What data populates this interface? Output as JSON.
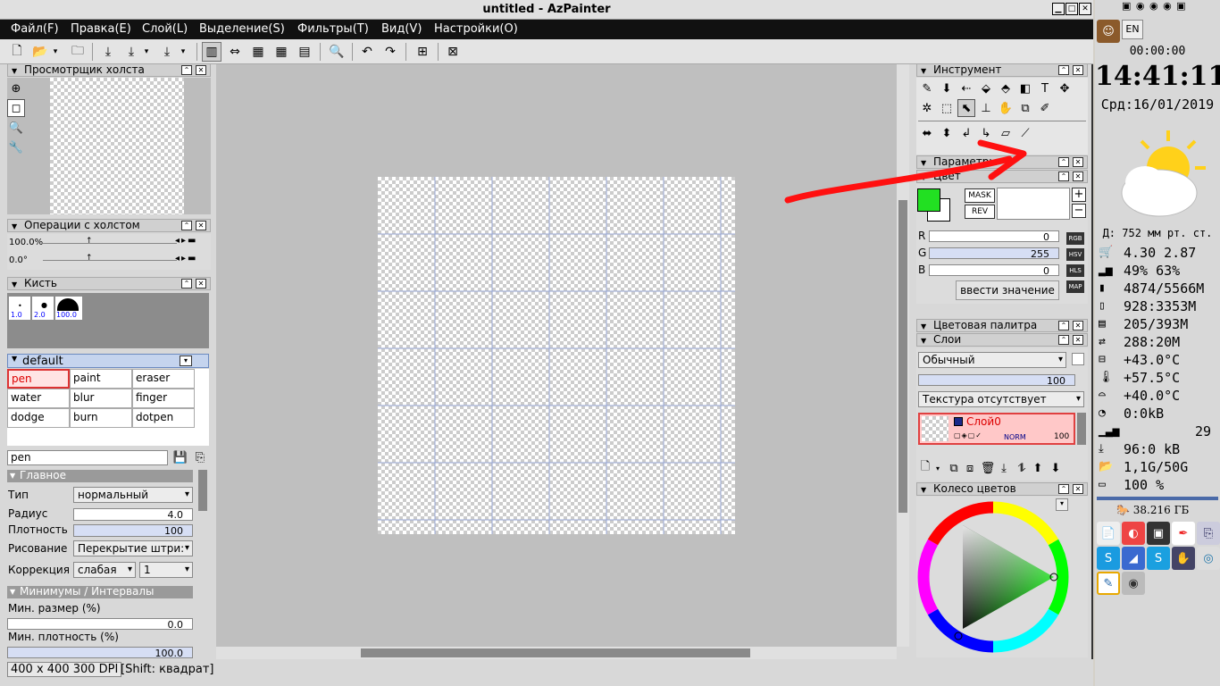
{
  "window": {
    "title": "untitled - AzPainter"
  },
  "menu": [
    "Файл(F)",
    "Правка(E)",
    "Слой(L)",
    "Выделение(S)",
    "Фильтры(T)",
    "Вид(V)",
    "Настройки(O)"
  ],
  "panels": {
    "viewer": "Просмотрщик холста",
    "canvas_ops": "Операции с холстом",
    "brush": "Кисть",
    "tool": "Инструмент",
    "params": "Параметры",
    "color": "Цвет",
    "palette": "Цветовая палитра",
    "layers": "Слои",
    "wheel": "Колесо цветов"
  },
  "canvas_ops": {
    "zoom": "100.0%",
    "angle": "0.0°"
  },
  "brush": {
    "sizes": [
      "1.0",
      "2.0",
      "100.0"
    ],
    "group": "default",
    "items": [
      [
        "pen",
        "paint",
        "eraser"
      ],
      [
        "water",
        "blur",
        "finger"
      ],
      [
        "dodge",
        "burn",
        "dotpen"
      ]
    ],
    "name": "pen",
    "section_main": "Главное",
    "type_label": "Тип",
    "type_value": "нормальный",
    "radius_label": "Радиус",
    "radius_value": "4.0",
    "density_label": "Плотность",
    "density_value": "100",
    "draw_label": "Рисование",
    "draw_value": "Перекрытие штри:",
    "corr_label": "Коррекция",
    "corr_value": "слабая",
    "corr_level": "1",
    "section_min": "Минимумы / Интервалы",
    "min_size_label": "Мин. размер (%)",
    "min_size_value": "0.0",
    "min_density_label": "Мин. плотность (%)",
    "min_density_value": "100.0"
  },
  "status": {
    "size": "400 x 400 300 DPI",
    "hint": "[Shift: квадрат]"
  },
  "color": {
    "mask": "MASK",
    "rev": "REV",
    "r": "0",
    "g": "255",
    "b": "0",
    "r_label": "R",
    "g_label": "G",
    "b_label": "B",
    "modes": [
      "RGB",
      "HSV",
      "HLS",
      "MAP"
    ],
    "enter": "ввести значение",
    "fg": "#22e022"
  },
  "layers": {
    "blend": "Обычный",
    "opacity": "100",
    "texture": "Текстура отсутствует",
    "layer_name": "Слой0",
    "mode": "NORM",
    "layer_opacity": "100"
  },
  "sys": {
    "lang": "EN",
    "timer": "00:00:00",
    "time": "14:41:11",
    "date": "Срд:16/01/2019",
    "pressure": "Д: 752 мм рт. ст.",
    "rows": [
      "4.30 2.87",
      "49% 63%",
      "4874/5566M",
      "928:3353M",
      "205/393M",
      "288:20M",
      "+43.0°C",
      "+57.5°C",
      "+40.0°C",
      "0:0kB",
      "29",
      "96:0 kB",
      "1,1G/50G",
      "100 %"
    ],
    "disk": "38.216 ГБ"
  }
}
